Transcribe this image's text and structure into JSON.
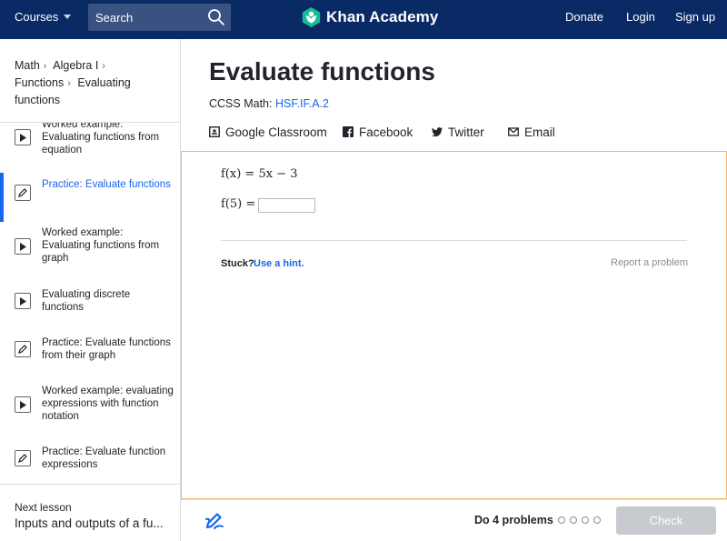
{
  "topbar": {
    "courses_label": "Courses",
    "search_placeholder": "Search",
    "brand_name": "Khan Academy",
    "donate_label": "Donate",
    "login_label": "Login",
    "signup_label": "Sign up"
  },
  "breadcrumb": [
    "Math",
    "Algebra I",
    "Functions",
    "Evaluating functions"
  ],
  "sidebar": {
    "items": [
      {
        "label": "Worked example: Evaluating functions from equation",
        "icon": "play-icon",
        "active": false
      },
      {
        "label": "Practice: Evaluate functions",
        "icon": "pencil-icon",
        "active": true
      },
      {
        "label": "Worked example: Evaluating functions from graph",
        "icon": "play-icon",
        "active": false
      },
      {
        "label": "Evaluating discrete functions",
        "icon": "play-icon",
        "active": false
      },
      {
        "label": "Practice: Evaluate functions from their graph",
        "icon": "pencil-icon",
        "active": false
      },
      {
        "label": "Worked example: evaluating expressions with function notation",
        "icon": "play-icon",
        "active": false
      },
      {
        "label": "Practice: Evaluate function expressions",
        "icon": "pencil-icon",
        "active": false
      }
    ],
    "next_label": "Next lesson",
    "next_title": "Inputs and outputs of a fu..."
  },
  "main": {
    "title": "Evaluate functions",
    "ccss_prefix": "CCSS Math:",
    "ccss_code": "HSF.IF.A.2",
    "share": {
      "google": "Google Classroom",
      "facebook": "Facebook",
      "twitter": "Twitter",
      "email": "Email"
    }
  },
  "exercise": {
    "equation": "f(x) = 5x − 3",
    "prompt": "f(5) =",
    "answer_value": "",
    "stuck_label": "Stuck?",
    "hint_label": "Use a hint.",
    "report_label": "Report a problem"
  },
  "footer": {
    "progress_label": "Do 4 problems",
    "progress_total": 4,
    "progress_done": 0,
    "check_label": "Check"
  },
  "colors": {
    "nav_background": "#0a2a66",
    "accent_blue": "#1865f2",
    "panel_border": "#f0b86e",
    "check_disabled": "#c7cacf"
  }
}
